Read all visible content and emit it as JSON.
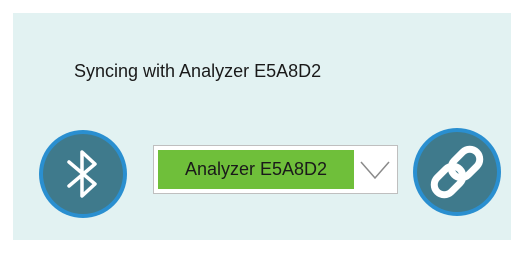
{
  "dialog": {
    "title": "Syncing with Analyzer E5A8D2"
  },
  "device_select": {
    "selected": "Analyzer E5A8D2"
  },
  "icons": {
    "bluetooth": "bluetooth-icon",
    "link": "link-icon",
    "dropdown": "chevron-down-icon"
  },
  "colors": {
    "panel_background": "#e2f2f2",
    "circle_fill": "#3f7a8c",
    "circle_ring": "#2a8fd0",
    "selected_highlight": "#6fbf3a"
  }
}
